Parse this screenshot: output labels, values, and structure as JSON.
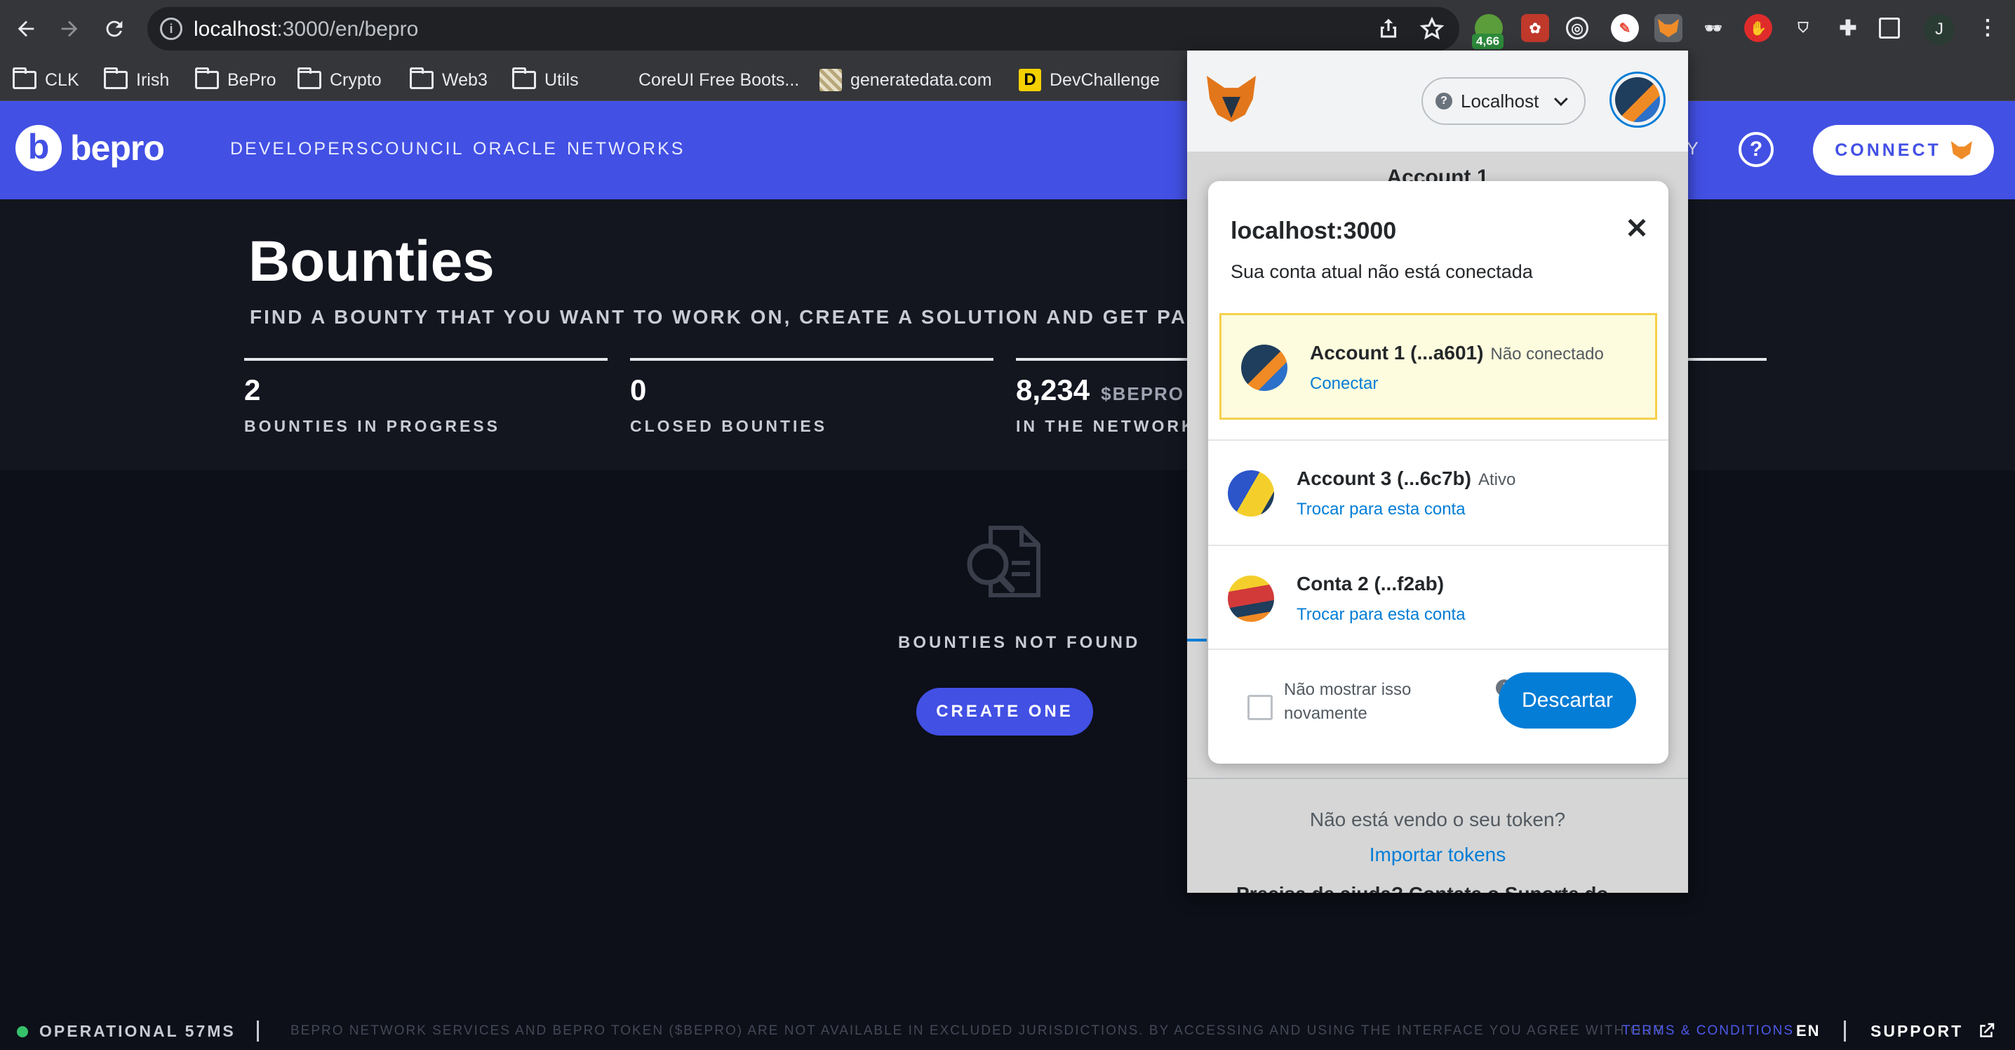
{
  "browser": {
    "url_host": "localhost",
    "url_path": ":3000/en/bepro",
    "extension_badge": "4,66",
    "profile_initial": "J",
    "bookmarks": [
      {
        "label": "CLK",
        "icon": "folder-icon"
      },
      {
        "label": "Irish",
        "icon": "folder-icon"
      },
      {
        "label": "BePro",
        "icon": "folder-icon"
      },
      {
        "label": "Crypto",
        "icon": "folder-icon"
      },
      {
        "label": "Web3",
        "icon": "folder-icon"
      },
      {
        "label": "Utils",
        "icon": "folder-icon"
      },
      {
        "label": "CoreUI Free Boots...",
        "icon": "coreui-icon"
      },
      {
        "label": "generatedata.com",
        "icon": "generatedata-icon"
      },
      {
        "label": "DevChallenge",
        "icon": "devchallenge-icon"
      }
    ]
  },
  "header": {
    "logo_text": "bepro",
    "nav": [
      "DEVELOPERS",
      "COUNCIL",
      "ORACLE",
      "NETWORKS"
    ],
    "nav_partial": "Y",
    "connect_label": "CONNECT",
    "accent_color": "#4250e4"
  },
  "hero": {
    "title": "Bounties",
    "subtitle": "FIND A BOUNTY THAT YOU WANT TO WORK ON, CREATE A SOLUTION AND GET PAID",
    "stats": [
      {
        "value": "2",
        "label": "BOUNTIES IN PROGRESS"
      },
      {
        "value": "0",
        "label": "CLOSED BOUNTIES"
      },
      {
        "value": "8,234",
        "token": "$BEPRO",
        "label": "IN THE NETWORK"
      }
    ]
  },
  "empty_state": {
    "text": "BOUNTIES NOT FOUND",
    "button": "CREATE ONE"
  },
  "footer": {
    "status": "OPERATIONAL 57MS",
    "disclaimer": "BEPRO NETWORK SERVICES AND BEPRO TOKEN ($BEPRO) ARE NOT AVAILABLE IN EXCLUDED JURISDICTIONS. BY ACCESSING AND USING THE INTERFACE YOU AGREE WITH OUR",
    "terms": "TERMS & CONDITIONS",
    "language": "EN",
    "support": "SUPPORT",
    "status_color": "#35c26a"
  },
  "metamask": {
    "network": "Localhost",
    "account_peek": "Account 1",
    "modal": {
      "title": "localhost:3000",
      "subtitle": "Sua conta atual não está conectada",
      "accounts": [
        {
          "name": "Account 1 (...a601)",
          "state": "Não conectado",
          "action": "Conectar"
        },
        {
          "name": "Account 3 (...6c7b)",
          "state": "Ativo",
          "action": "Trocar para esta conta"
        },
        {
          "name": "Conta 2 (...f2ab)",
          "state": "",
          "action": "Trocar para esta conta"
        }
      ],
      "dont_show": "Não mostrar isso novamente",
      "dismiss": "Descartar"
    },
    "bg_text": "Não está vendo o seu token?",
    "bg_link": "Importar tokens",
    "bg_cut": "Precisa de ajuda? Contate o Suporte do",
    "link_color": "#037dd6"
  }
}
